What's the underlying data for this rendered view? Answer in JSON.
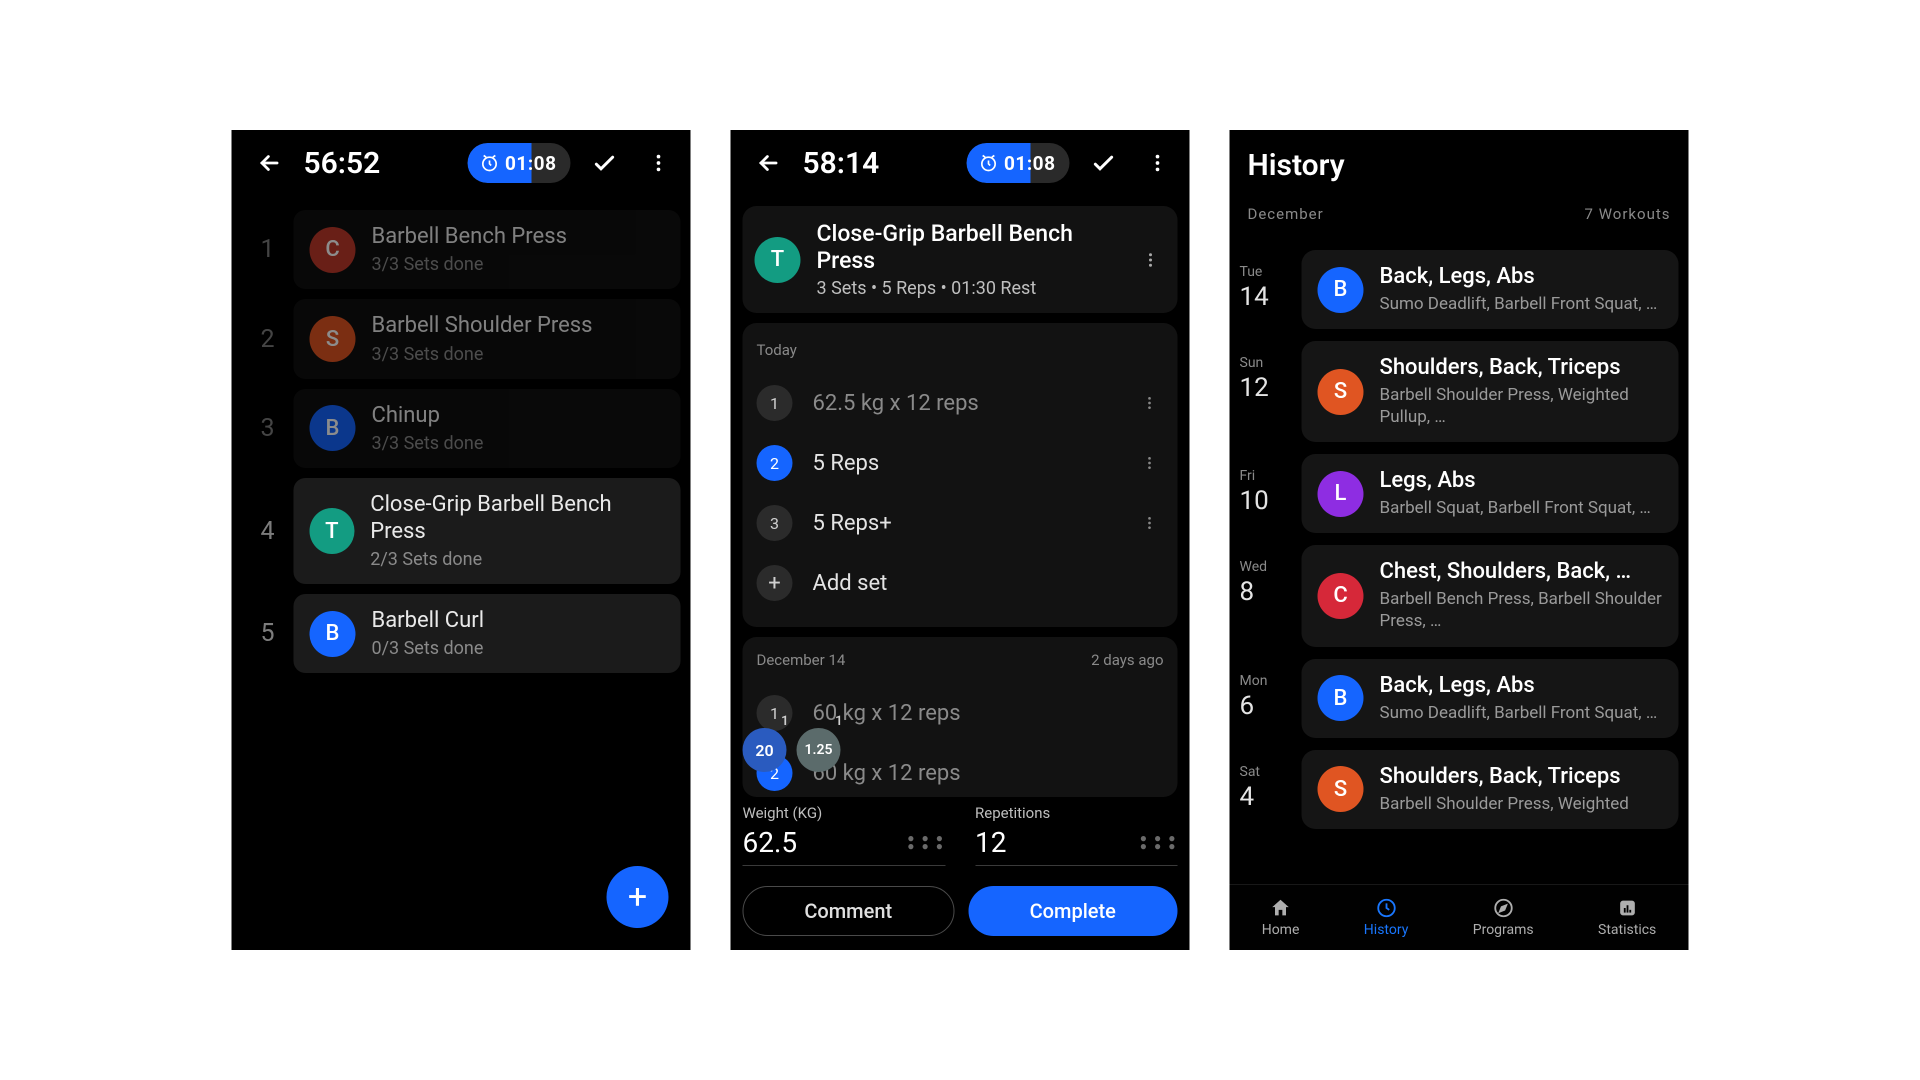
{
  "screen1": {
    "time": "56:52",
    "timer": "01:08",
    "exercises": [
      {
        "n": "1",
        "letter": "C",
        "color": "c-red",
        "name": "Barbell Bench Press",
        "sub": "3/3 Sets done",
        "dim": true
      },
      {
        "n": "2",
        "letter": "S",
        "color": "c-orange",
        "name": "Barbell Shoulder Press",
        "sub": "3/3 Sets done",
        "dim": true
      },
      {
        "n": "3",
        "letter": "B",
        "color": "c-blue",
        "name": "Chinup",
        "sub": "3/3 Sets done",
        "dim": true
      },
      {
        "n": "4",
        "letter": "T",
        "color": "c-teal",
        "name": "Close-Grip Barbell Bench Press",
        "sub": "2/3 Sets done",
        "dim": false
      },
      {
        "n": "5",
        "letter": "B",
        "color": "c-blue",
        "name": "Barbell Curl",
        "sub": "0/3 Sets done",
        "dim": false
      }
    ]
  },
  "screen2": {
    "time": "58:14",
    "timer": "01:08",
    "exercise": {
      "letter": "T",
      "color": "c-teal",
      "name": "Close-Grip Barbell Bench Press",
      "sub": "3 Sets • 5 Reps • 01:30 Rest"
    },
    "today_label": "Today",
    "today_sets": [
      {
        "n": "1",
        "text": "62.5 kg x 12 reps",
        "state": "done"
      },
      {
        "n": "2",
        "text": "5 Reps",
        "state": "active"
      },
      {
        "n": "3",
        "text": "5 Reps+",
        "state": "pending"
      }
    ],
    "add_set_label": "Add set",
    "prev_date": "December 14",
    "prev_ago": "2 days ago",
    "prev_sets": [
      {
        "n": "1",
        "text": "60 kg x 12 reps",
        "state": "done"
      },
      {
        "n": "2",
        "text": "60 kg x 12 reps",
        "state": "active"
      }
    ],
    "chips": [
      {
        "label": "20",
        "sup": "1",
        "cls": "chip-blue"
      },
      {
        "label": "1.25",
        "sup": "1",
        "cls": "chip-grey"
      }
    ],
    "weight_label": "Weight (KG)",
    "weight_value": "62.5",
    "reps_label": "Repetitions",
    "reps_value": "12",
    "comment_btn": "Comment",
    "complete_btn": "Complete"
  },
  "screen3": {
    "title": "History",
    "month": "December",
    "count": "7 Workouts",
    "items": [
      {
        "dow": "Tue",
        "day": "14",
        "letter": "B",
        "color": "c-blue",
        "title": "Back, Legs, Abs",
        "sub": "Sumo Deadlift, Barbell Front Squat, …"
      },
      {
        "dow": "Sun",
        "day": "12",
        "letter": "S",
        "color": "c-orange",
        "title": "Shoulders, Back, Triceps",
        "sub": "Barbell Shoulder Press, Weighted Pullup, …"
      },
      {
        "dow": "Fri",
        "day": "10",
        "letter": "L",
        "color": "c-purple",
        "title": "Legs, Abs",
        "sub": "Barbell Squat, Barbell Front Squat, …"
      },
      {
        "dow": "Wed",
        "day": "8",
        "letter": "C",
        "color": "c-crimson",
        "title": "Chest, Shoulders, Back, …",
        "sub": "Barbell Bench Press, Barbell Shoulder Press, …"
      },
      {
        "dow": "Mon",
        "day": "6",
        "letter": "B",
        "color": "c-blue",
        "title": "Back, Legs, Abs",
        "sub": "Sumo Deadlift, Barbell Front Squat, …"
      },
      {
        "dow": "Sat",
        "day": "4",
        "letter": "S",
        "color": "c-orange",
        "title": "Shoulders, Back, Triceps",
        "sub": "Barbell Shoulder Press, Weighted"
      }
    ],
    "nav": {
      "home": "Home",
      "history": "History",
      "programs": "Programs",
      "stats": "Statistics"
    }
  }
}
